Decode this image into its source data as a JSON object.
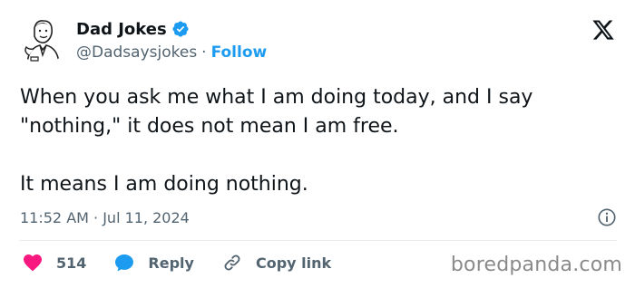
{
  "author": {
    "display_name": "Dad Jokes",
    "handle": "@Dadsaysjokes",
    "separator": "·",
    "follow_label": "Follow"
  },
  "tweet": {
    "paragraphs": [
      "When you ask me what I am doing today, and I say \"nothing,\" it does not mean I am free.",
      "It means I am doing nothing."
    ],
    "timestamp": "11:52 AM · Jul 11, 2024"
  },
  "actions": {
    "like_count": "514",
    "reply_label": "Reply",
    "copy_link_label": "Copy link"
  },
  "watermark": "boredpanda.com",
  "icons": {
    "avatar": "cartoon-dad-avatar",
    "verified": "verified-badge-icon",
    "x_logo": "x-logo-icon",
    "info": "info-icon",
    "like": "heart-icon",
    "reply": "speech-bubble-icon",
    "copy_link": "link-icon"
  },
  "colors": {
    "accent": "#1d9bf0",
    "like": "#f91880",
    "text_primary": "#0f1419",
    "text_secondary": "#536471"
  }
}
